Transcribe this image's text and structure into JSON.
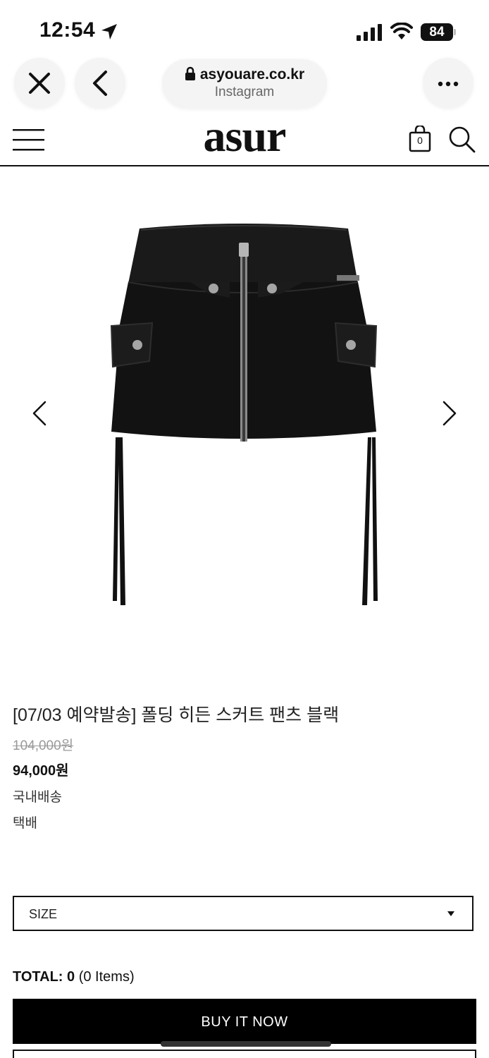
{
  "status_bar": {
    "time": "12:54",
    "battery": "84",
    "icons": [
      "location-arrow-icon",
      "signal-icon",
      "wifi-icon",
      "battery-icon"
    ]
  },
  "browser": {
    "url": "asyouare.co.kr",
    "source": "Instagram",
    "icons": [
      "close-icon",
      "back-icon",
      "lock-icon",
      "more-icon"
    ]
  },
  "header": {
    "logo": "asur",
    "cart_count": "0",
    "icons": [
      "menu-icon",
      "cart-icon",
      "search-icon"
    ]
  },
  "product": {
    "title": "[07/03 예약발송] 폴딩 히든 스커트 팬츠 블랙",
    "original_price": "104,000원",
    "sale_price": "94,000원",
    "shipping_region": "국내배송",
    "shipping_method": "택배",
    "image": "black folded-waist zip mini skirt with cargo pockets and side drawstrings"
  },
  "options": {
    "size_placeholder": "SIZE"
  },
  "total": {
    "label": "TOTAL: ",
    "amount": "0",
    "items": " (0 Items)"
  },
  "actions": {
    "buy_now": "BUY IT NOW"
  },
  "colors": {
    "primary": "#000000",
    "text": "#111111",
    "muted": "#999999",
    "chrome": "#f4f4f4"
  }
}
